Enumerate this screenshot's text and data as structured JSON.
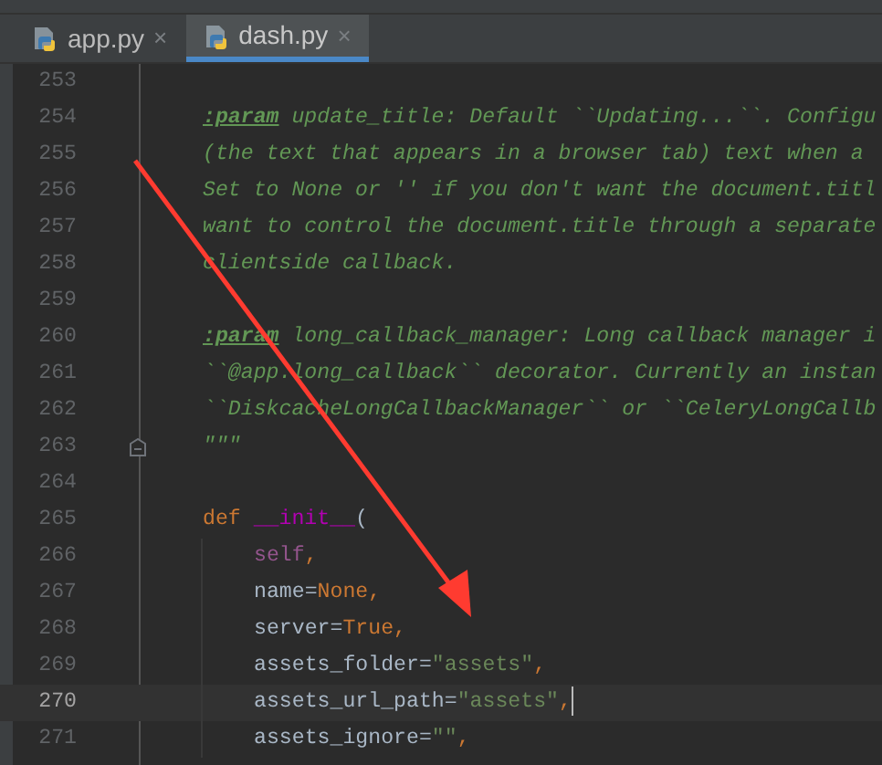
{
  "tabs": [
    {
      "label": "app.py",
      "close": "×",
      "selected": false
    },
    {
      "label": "dash.py",
      "close": "×",
      "selected": true
    }
  ],
  "editor": {
    "lines": [
      {
        "number": "253",
        "current": false
      },
      {
        "number": "254",
        "current": false,
        "tokens": [
          {
            "text": ":param",
            "kind": "doc-tag"
          },
          {
            "text": " update_title: Default ``Updating...``. Configu",
            "kind": "doc"
          }
        ]
      },
      {
        "number": "255",
        "current": false,
        "tokens": [
          {
            "text": "(the text that appears in a browser tab) text when a",
            "kind": "doc"
          }
        ]
      },
      {
        "number": "256",
        "current": false,
        "tokens": [
          {
            "text": "Set to None or '' if you don't want the document.titl",
            "kind": "doc"
          }
        ]
      },
      {
        "number": "257",
        "current": false,
        "tokens": [
          {
            "text": "want to control the document.title through a separate",
            "kind": "doc"
          }
        ]
      },
      {
        "number": "258",
        "current": false,
        "tokens": [
          {
            "text": "clientside callback.",
            "kind": "doc"
          }
        ]
      },
      {
        "number": "259",
        "current": false
      },
      {
        "number": "260",
        "current": false,
        "tokens": [
          {
            "text": ":param",
            "kind": "doc-tag"
          },
          {
            "text": " long_callback_manager: Long callback manager i",
            "kind": "doc"
          }
        ]
      },
      {
        "number": "261",
        "current": false,
        "tokens": [
          {
            "text": "``@app.long_callback`` decorator. Currently an instan",
            "kind": "doc"
          }
        ]
      },
      {
        "number": "262",
        "current": false,
        "tokens": [
          {
            "text": "``DiskcacheLongCallbackManager`` or ``CeleryLongCallb",
            "kind": "doc"
          }
        ]
      },
      {
        "number": "263",
        "current": false,
        "fold": true,
        "tokens": [
          {
            "text": "\"\"\"",
            "kind": "doc"
          }
        ]
      },
      {
        "number": "264",
        "current": false
      },
      {
        "number": "265",
        "current": false,
        "tokens": [
          {
            "text": "def ",
            "kind": "keyword"
          },
          {
            "text": "__init__",
            "kind": "magic"
          },
          {
            "text": "(",
            "kind": "plain"
          }
        ],
        "children": [
          {
            "number": "266",
            "current": false,
            "tokens": [
              {
                "text": "self",
                "kind": "self"
              },
              {
                "text": ",",
                "kind": "keyword"
              }
            ]
          },
          {
            "number": "267",
            "current": false,
            "tokens": [
              {
                "text": "name=",
                "kind": "plain"
              },
              {
                "text": "None",
                "kind": "keyword"
              },
              {
                "text": ",",
                "kind": "keyword"
              }
            ]
          },
          {
            "number": "268",
            "current": false,
            "tokens": [
              {
                "text": "server=",
                "kind": "plain"
              },
              {
                "text": "True",
                "kind": "keyword"
              },
              {
                "text": ",",
                "kind": "keyword"
              }
            ]
          },
          {
            "number": "269",
            "current": false,
            "tokens": [
              {
                "text": "assets_folder=",
                "kind": "plain"
              },
              {
                "text": "\"assets\"",
                "kind": "string"
              },
              {
                "text": ",",
                "kind": "keyword"
              }
            ]
          },
          {
            "number": "270",
            "current": true,
            "tokens": [
              {
                "text": "assets_url_path=",
                "kind": "plain"
              },
              {
                "text": "\"assets\"",
                "kind": "string"
              },
              {
                "text": ",",
                "kind": "keyword"
              }
            ]
          },
          {
            "number": "271",
            "current": false,
            "tokens": [
              {
                "text": "assets_ignore=",
                "kind": "plain"
              },
              {
                "text": "\"\"",
                "kind": "string"
              },
              {
                "text": ",",
                "kind": "keyword"
              }
            ]
          }
        ]
      }
    ]
  }
}
